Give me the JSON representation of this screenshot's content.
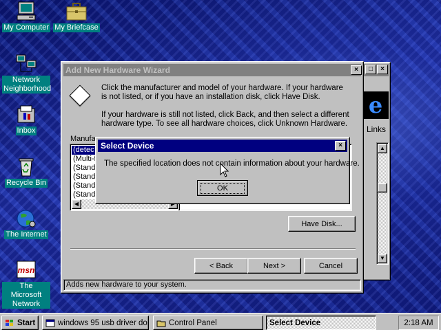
{
  "desktop": {
    "icons": [
      {
        "label": "My Computer"
      },
      {
        "label": "My Briefcase"
      },
      {
        "label": "Network Neighborhood"
      },
      {
        "label": "Inbox"
      },
      {
        "label": "Recycle Bin"
      },
      {
        "label": "The Internet"
      },
      {
        "label": "The Microsoft Network"
      }
    ]
  },
  "ie_window": {
    "links_label": "Links"
  },
  "wizard": {
    "title": "Add New Hardware Wizard",
    "paragraph1": "Click the manufacturer and model of your hardware. If your hardware is not listed, or if you have an installation disk, click Have Disk.",
    "paragraph2": "If your hardware is still not listed, click Back, and then select a different hardware type. To see all hardware choices, click Unknown Hardware.",
    "manufacturers_label": "Manufa",
    "manufacturers": [
      "(detec",
      "(Multi-f",
      "(Stand",
      "(Stand",
      "(Stand",
      "(Stand"
    ],
    "have_disk_label": "Have Disk...",
    "back_label": "< Back",
    "next_label": "Next >",
    "cancel_label": "Cancel",
    "status_text": "Adds new hardware to your system."
  },
  "dialog": {
    "title": "Select Device",
    "message": "The specified location does not contain information about your hardware.",
    "ok_label": "OK"
  },
  "taskbar": {
    "start_label": "Start",
    "tasks": [
      {
        "label": "windows 95 usb driver do..."
      },
      {
        "label": "Control Panel"
      },
      {
        "label": "Select Device"
      }
    ],
    "clock": "2:18 AM"
  },
  "colors": {
    "desktop": "#1b2a8c",
    "title_active": "#000080",
    "title_inactive": "#808080",
    "face": "#c0c0c0"
  }
}
